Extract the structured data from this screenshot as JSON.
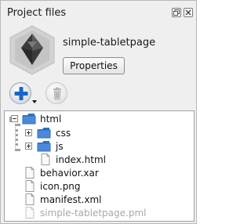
{
  "panel": {
    "title": "Project files",
    "float_icon": "float-icon",
    "close_icon": "close-icon"
  },
  "project": {
    "name": "simple-tabletpage",
    "properties_label": "Properties",
    "logo_icon": "choregraphe-logo-icon"
  },
  "toolbar": {
    "add_icon": "add-plus-icon",
    "add_menu_icon": "dropdown-arrow-icon",
    "delete_icon": "trash-icon"
  },
  "tree": {
    "items": [
      {
        "label": "html",
        "type": "folder",
        "expanded": true,
        "level": 0
      },
      {
        "label": "css",
        "type": "folder",
        "expanded": false,
        "level": 1
      },
      {
        "label": "js",
        "type": "folder",
        "expanded": false,
        "level": 1
      },
      {
        "label": "index.html",
        "type": "file",
        "level": 1
      },
      {
        "label": "behavior.xar",
        "type": "file",
        "level": 0
      },
      {
        "label": "icon.png",
        "type": "file",
        "level": 0
      },
      {
        "label": "manifest.xml",
        "type": "file",
        "level": 0
      },
      {
        "label": "simple-tabletpage.pml",
        "type": "file",
        "level": 0,
        "dimmed": true
      }
    ]
  },
  "colors": {
    "panel_bg": "#efefef",
    "folder_blue": "#3f7fd0",
    "add_blue": "#1a64c8",
    "dimmed_text": "#a8a8a8"
  }
}
